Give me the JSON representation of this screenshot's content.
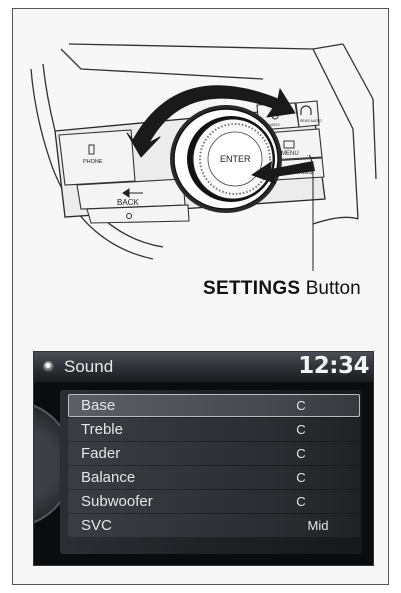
{
  "illustration": {
    "callout_strong": "SETTINGS",
    "callout_rest": "Button",
    "console_labels": {
      "phone": "PHONE",
      "back": "BACK",
      "enter": "ENTER",
      "menu": "MENU",
      "settings": "SETTINGS",
      "audio": "AUDIO",
      "rear_audio": "REAR AUDIO"
    }
  },
  "screen": {
    "title": "Sound",
    "clock": "12:34",
    "items": [
      {
        "label": "Base",
        "value": "C"
      },
      {
        "label": "Treble",
        "value": "C"
      },
      {
        "label": "Fader",
        "value": "C"
      },
      {
        "label": "Balance",
        "value": "C"
      },
      {
        "label": "Subwoofer",
        "value": "C"
      },
      {
        "label": "SVC",
        "value": "Mid"
      }
    ],
    "selected_index": 0
  }
}
